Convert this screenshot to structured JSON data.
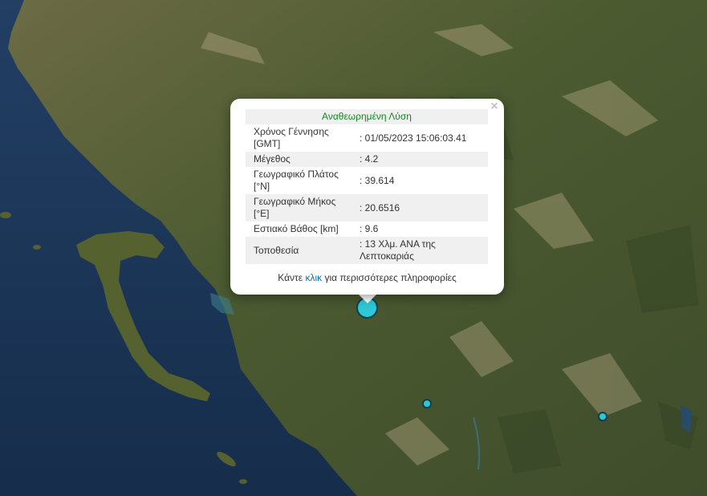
{
  "map": {
    "water_color": "#1b3556",
    "land_color": "#4e5a33",
    "marker_color": "#2ec7d6",
    "markers": [
      {
        "name": "selected-earthquake-marker",
        "lat": 39.614,
        "lon": 20.6516
      },
      {
        "name": "earthquake-marker",
        "lat": null,
        "lon": null
      },
      {
        "name": "earthquake-marker",
        "lat": null,
        "lon": null
      }
    ]
  },
  "popup": {
    "title": "Αναθεωρημένη Λύση",
    "close_label": "×",
    "title_color": "#0f8a1c",
    "rows": [
      {
        "label": "Χρόνος Γέννησης [GMT]",
        "value": ": 01/05/2023 15:06:03.41"
      },
      {
        "label": "Μέγεθος",
        "value": ": 4.2"
      },
      {
        "label": "Γεωγραφικό Πλάτος [°N]",
        "value": ": 39.614"
      },
      {
        "label": "Γεωγραφικό Μήκος [°E]",
        "value": ": 20.6516"
      },
      {
        "label": "Εστιακό Βάθος [km]",
        "value": ": 9.6"
      },
      {
        "label": "Τοποθεσία",
        "value": ": 13 Χλμ. ΑΝΑ της Λεπτοκαριάς"
      }
    ],
    "more_prefix": "Κάντε",
    "more_link": "κλικ",
    "more_suffix": "για περισσότερες πληροφορίες",
    "link_color": "#0078a8"
  }
}
